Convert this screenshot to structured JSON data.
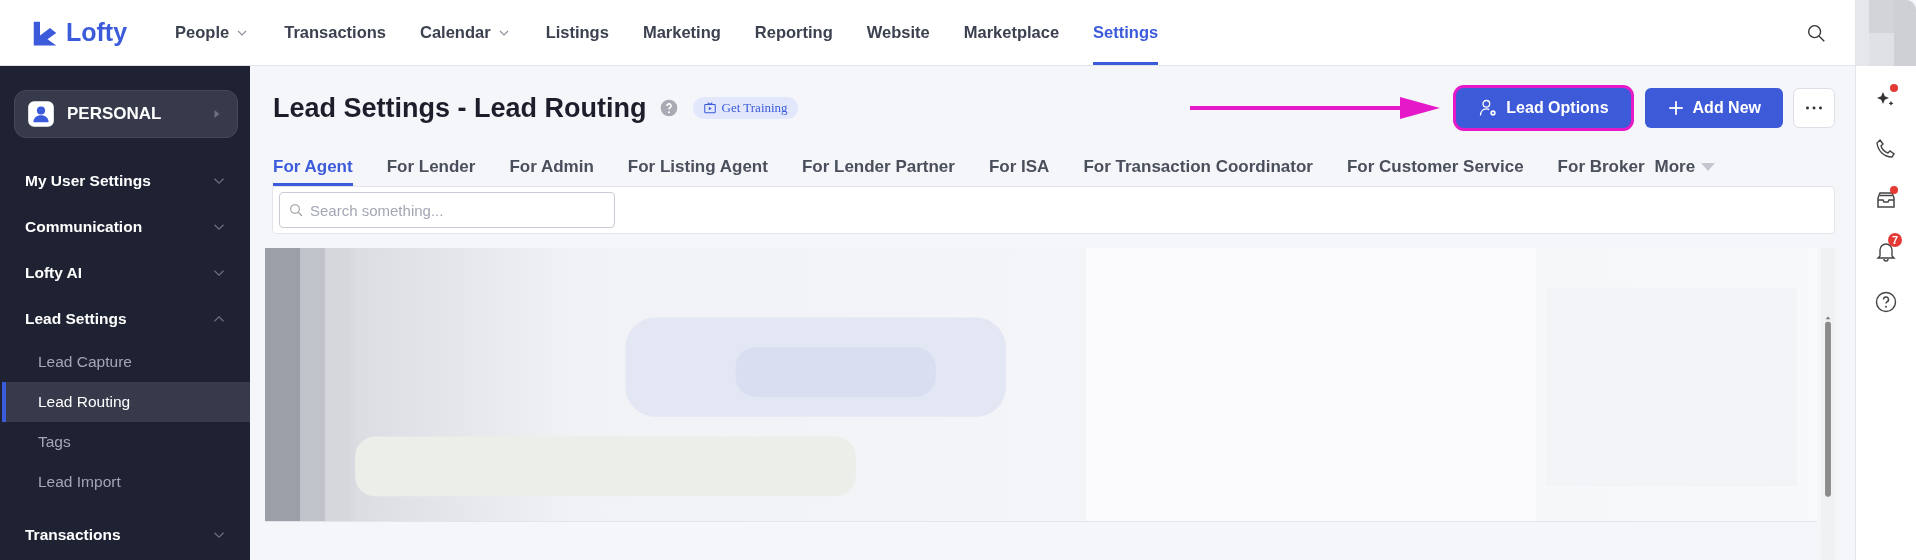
{
  "brand": {
    "name": "Lofty"
  },
  "nav": [
    {
      "label": "People",
      "dropdown": true,
      "selected": false
    },
    {
      "label": "Transactions",
      "dropdown": false,
      "selected": false
    },
    {
      "label": "Calendar",
      "dropdown": true,
      "selected": false
    },
    {
      "label": "Listings",
      "dropdown": false,
      "selected": false
    },
    {
      "label": "Marketing",
      "dropdown": false,
      "selected": false
    },
    {
      "label": "Reporting",
      "dropdown": false,
      "selected": false
    },
    {
      "label": "Website",
      "dropdown": false,
      "selected": false
    },
    {
      "label": "Marketplace",
      "dropdown": false,
      "selected": false
    },
    {
      "label": "Settings",
      "dropdown": false,
      "selected": true
    }
  ],
  "sidebar": {
    "account": "PERSONAL",
    "sections": [
      {
        "label": "My User Settings",
        "expanded": false
      },
      {
        "label": "Communication",
        "expanded": false
      },
      {
        "label": "Lofty AI",
        "expanded": false
      },
      {
        "label": "Lead Settings",
        "expanded": true,
        "children": [
          {
            "label": "Lead Capture",
            "selected": false
          },
          {
            "label": "Lead Routing",
            "selected": true
          },
          {
            "label": "Tags",
            "selected": false
          },
          {
            "label": "Lead Import",
            "selected": false
          }
        ]
      },
      {
        "label": "Transactions",
        "expanded": false
      }
    ]
  },
  "page": {
    "title": "Lead Settings - Lead Routing",
    "training": "Get Training",
    "buttons": [
      {
        "kind": "options",
        "label": "Lead Options",
        "highlighted": true
      },
      {
        "kind": "add",
        "label": "Add New",
        "highlighted": false
      },
      {
        "kind": "more",
        "highlighted": false
      }
    ],
    "tabs": [
      {
        "label": "For Agent",
        "selected": true,
        "dropdown": false
      },
      {
        "label": "For Lender",
        "selected": false,
        "dropdown": false
      },
      {
        "label": "For Admin",
        "selected": false,
        "dropdown": false
      },
      {
        "label": "For Listing Agent",
        "selected": false,
        "dropdown": false
      },
      {
        "label": "For Lender Partner",
        "selected": false,
        "dropdown": false
      },
      {
        "label": "For ISA",
        "selected": false,
        "dropdown": false
      },
      {
        "label": "For Transaction Coordinator",
        "selected": false,
        "dropdown": false
      },
      {
        "label": "For Customer Service",
        "selected": false,
        "dropdown": false
      },
      {
        "label": "For Broker",
        "selected": false,
        "dropdown": false
      },
      {
        "label": "More",
        "selected": false,
        "dropdown": true
      }
    ],
    "search": {
      "placeholder": "Search something..."
    }
  },
  "rail": [
    {
      "kind": "sparkle",
      "dot": true
    },
    {
      "kind": "phone",
      "dot": false
    },
    {
      "kind": "inbox",
      "dot": true
    },
    {
      "kind": "bell",
      "dot": false,
      "badge": "7"
    },
    {
      "kind": "help",
      "dot": false
    }
  ]
}
